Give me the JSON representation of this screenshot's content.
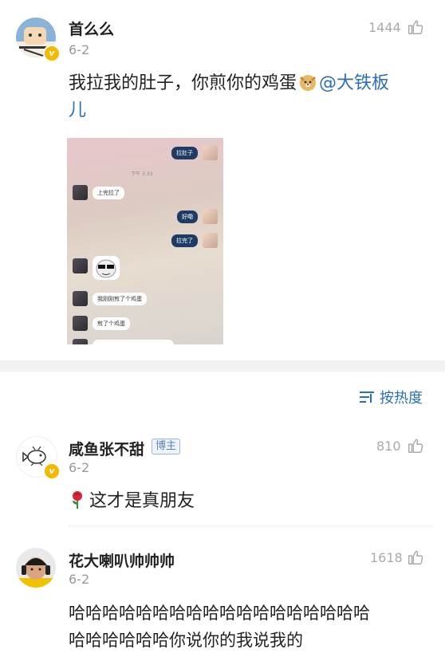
{
  "post": {
    "author": "首么么",
    "date": "6-2",
    "likes": "1444",
    "text": "我拉我的肚子，你煎你的鸡蛋",
    "mention": "@大铁板儿",
    "mention_line1": "@大铁板",
    "mention_line2": "儿",
    "emoji_icon": "doge-emoji-icon",
    "chat_screenshot": {
      "system": "下午 3:33",
      "messages": [
        {
          "side": "right",
          "text": "拉肚子"
        },
        {
          "side": "left",
          "text": "上完拉了"
        },
        {
          "side": "right",
          "text": "好嘞"
        },
        {
          "side": "right",
          "text": "拉完了"
        },
        {
          "side": "left",
          "text": ""
        },
        {
          "side": "left",
          "text": "我刚刚煎了个鸡蛋"
        },
        {
          "side": "left",
          "text": "煎了个鸡蛋"
        },
        {
          "side": "left",
          "text": ""
        }
      ]
    }
  },
  "sort": {
    "label": "按热度",
    "icon": "sort-icon"
  },
  "comments": [
    {
      "author": "咸鱼张不甜",
      "badge": "博主",
      "date": "6-2",
      "likes": "810",
      "emoji_icon": "rose-icon",
      "text": "这才是真朋友"
    },
    {
      "author": "花大喇叭帅帅帅",
      "date": "6-2",
      "likes": "1618",
      "text_line1": "哈哈哈哈哈哈哈哈哈哈哈哈哈哈哈哈哈哈",
      "text_line2": "哈哈哈哈哈哈你说你的我说我的"
    }
  ],
  "colors": {
    "accent": "#2a6fb5",
    "verified": "#f5b800",
    "muted": "#999999"
  }
}
